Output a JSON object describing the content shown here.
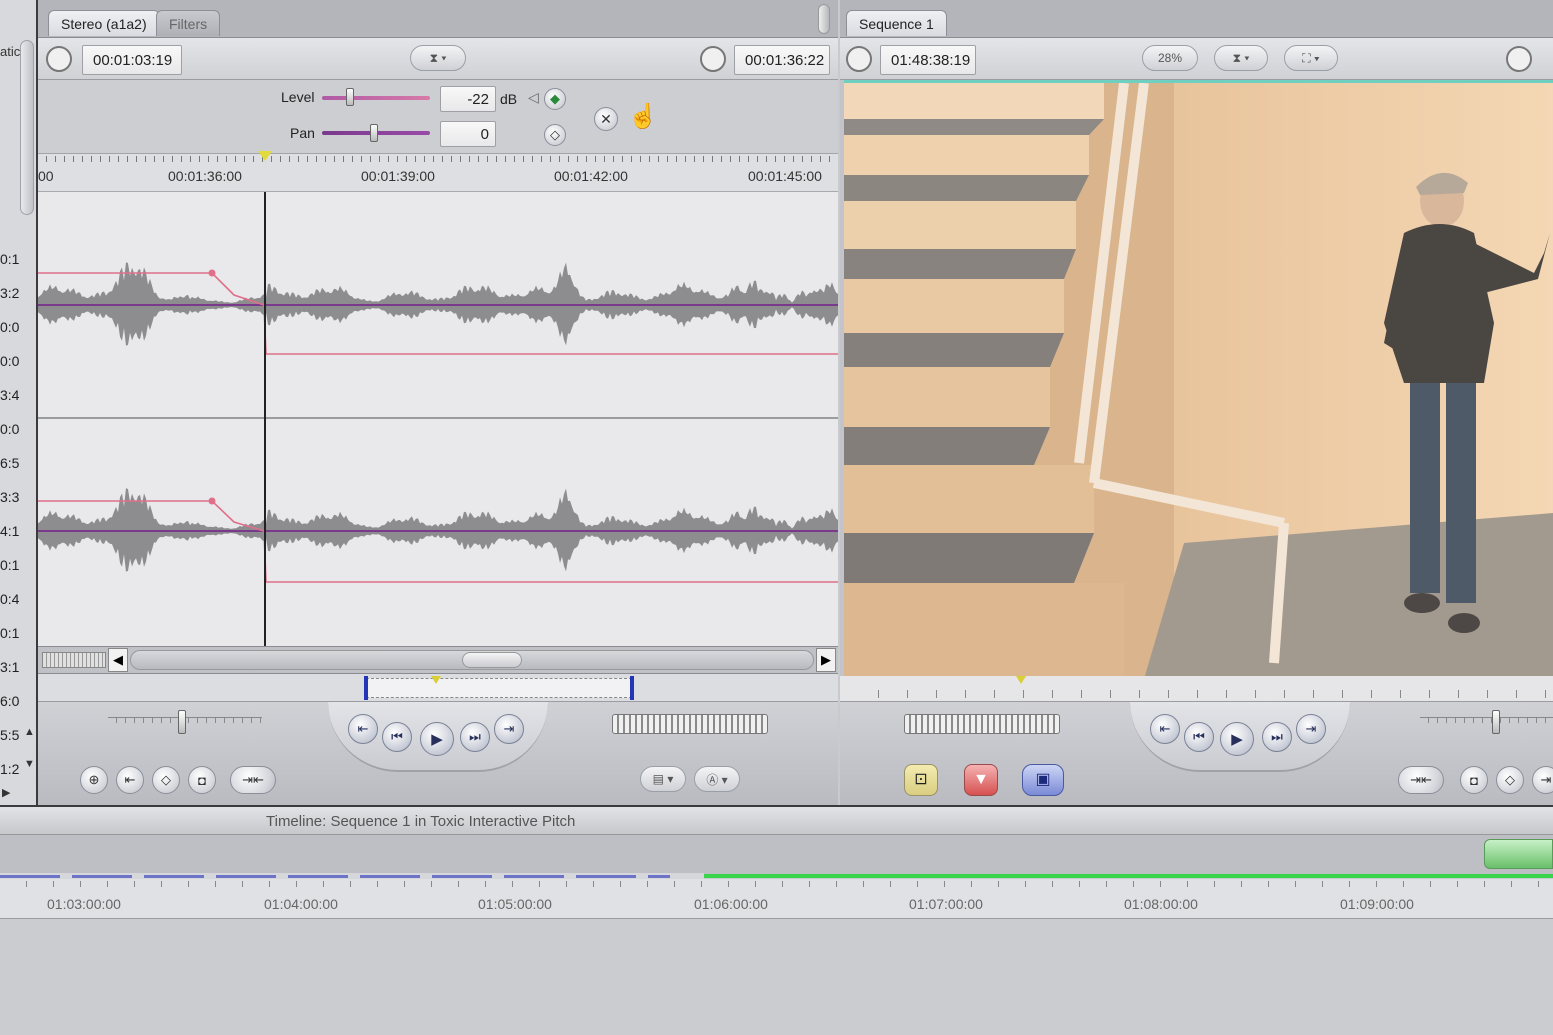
{
  "viewer": {
    "tabs": [
      {
        "label": "Stereo (a1a2)"
      },
      {
        "label": "Filters"
      }
    ],
    "timecode_current": "00:01:03:19",
    "timecode_duration": "00:01:36:22",
    "level_label": "Level",
    "level_value": "-22",
    "level_unit": "dB",
    "pan_label": "Pan",
    "pan_value": "0",
    "ruler_labels": [
      "00",
      "00:01:36:00",
      "00:01:39:00",
      "00:01:42:00",
      "00:01:45:00"
    ]
  },
  "canvas": {
    "tab_label": "Sequence 1",
    "timecode": "01:48:38:19",
    "zoom": "28%"
  },
  "timeline": {
    "title": "Timeline: Sequence 1 in Toxic Interactive Pitch",
    "ruler_labels": [
      "01:03:00:00",
      "01:04:00:00",
      "01:05:00:00",
      "01:06:00:00",
      "01:07:00:00",
      "01:08:00:00",
      "01:09:00:00"
    ]
  },
  "browser_strip": {
    "header": "atic",
    "values": [
      "0:1",
      "3:2",
      "0:0",
      "0:0",
      "3:4",
      "0:0",
      "6:5",
      "3:3",
      "4:1",
      "0:1",
      "0:4",
      "0:1",
      "3:1",
      "6:0",
      "5:5",
      "1:2"
    ]
  },
  "colors": {
    "panel_bg": "#c9cace",
    "waveform": "#8d8d8f",
    "level_line": "#e0708a",
    "pan_line": "#7a3a8c",
    "accent_green": "#39d44b"
  }
}
